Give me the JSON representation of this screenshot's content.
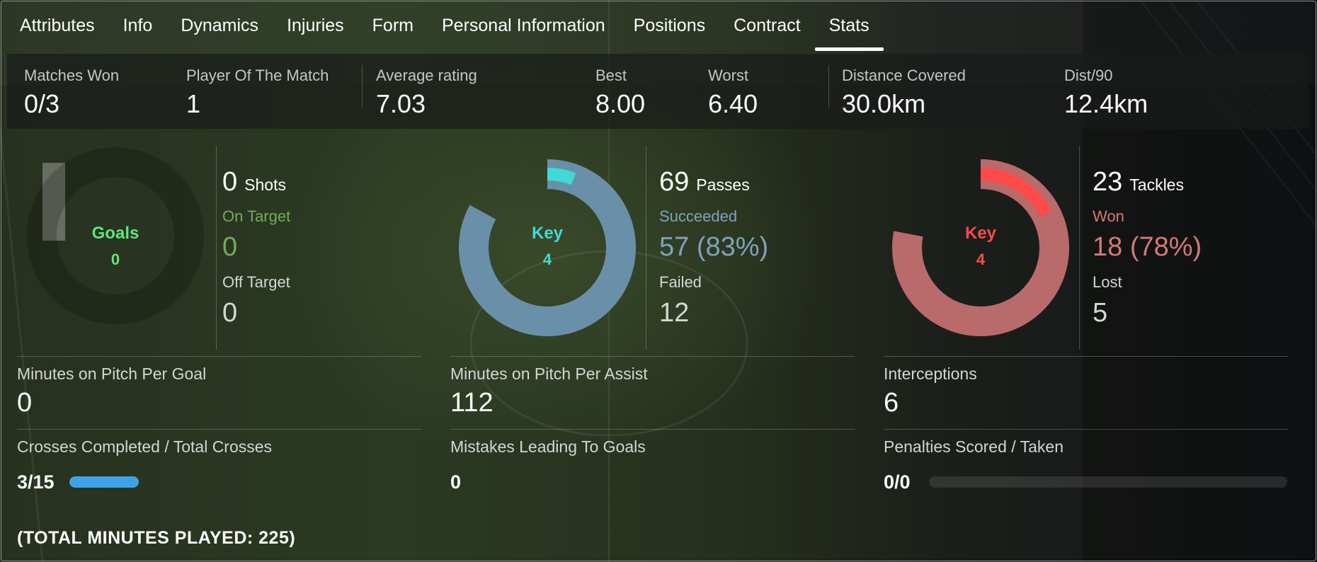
{
  "tabs": [
    "Attributes",
    "Info",
    "Dynamics",
    "Injuries",
    "Form",
    "Personal Information",
    "Positions",
    "Contract",
    "Stats"
  ],
  "active_tab": "Stats",
  "summary": {
    "matches_won": {
      "label": "Matches Won",
      "value": "0/3"
    },
    "potm": {
      "label": "Player Of The Match",
      "value": "1"
    },
    "avg_rating": {
      "label": "Average rating",
      "value": "7.03"
    },
    "best": {
      "label": "Best",
      "value": "8.00"
    },
    "worst": {
      "label": "Worst",
      "value": "6.40"
    },
    "distance": {
      "label": "Distance Covered",
      "value": "30.0km"
    },
    "dist90": {
      "label": "Dist/90",
      "value": "12.4km"
    }
  },
  "shots": {
    "donut_title": "Goals",
    "donut_value": "0",
    "count": "0",
    "title": "Shots",
    "on_target_label": "On Target",
    "on_target_value": "0",
    "off_target_label": "Off Target",
    "off_target_value": "0",
    "succeeded_fraction": 0,
    "key_fraction": 0
  },
  "passes": {
    "donut_title": "Key",
    "donut_value": "4",
    "count": "69",
    "title": "Passes",
    "succeeded_label": "Succeeded",
    "succeeded_value": "57 (83%)",
    "failed_label": "Failed",
    "failed_value": "12",
    "succeeded_fraction": 0.83,
    "key_fraction": 0.058
  },
  "tackles": {
    "donut_title": "Key",
    "donut_value": "4",
    "count": "23",
    "title": "Tackles",
    "won_label": "Won",
    "won_value": "18 (78%)",
    "lost_label": "Lost",
    "lost_value": "5",
    "succeeded_fraction": 0.78,
    "key_fraction": 0.174
  },
  "metrics": {
    "mins_per_goal": {
      "label": "Minutes on Pitch Per Goal",
      "value": "0"
    },
    "mins_per_assist": {
      "label": "Minutes on Pitch Per Assist",
      "value": "112"
    },
    "interceptions": {
      "label": "Interceptions",
      "value": "6"
    },
    "crosses": {
      "label": "Crosses Completed / Total Crosses",
      "value": "3/15",
      "fraction": 0.2
    },
    "mistakes": {
      "label": "Mistakes Leading To Goals",
      "value": "0"
    },
    "penalties": {
      "label": "Penalties Scored / Taken",
      "value": "0/0",
      "fraction": 0
    }
  },
  "footer": "(TOTAL MINUTES PLAYED: 225)",
  "colors": {
    "goals_accent": "#5ee57b",
    "on_target": "#6fae56",
    "passes_ring": "#6a8fa8",
    "passes_key": "#40d9d6",
    "passes_text": "#7fa2ba",
    "tackles_ring": "#b96a6b",
    "tackles_key": "#ff4a4a",
    "tackles_text": "#d17a76",
    "cross_bar": "#3ea3e6"
  }
}
